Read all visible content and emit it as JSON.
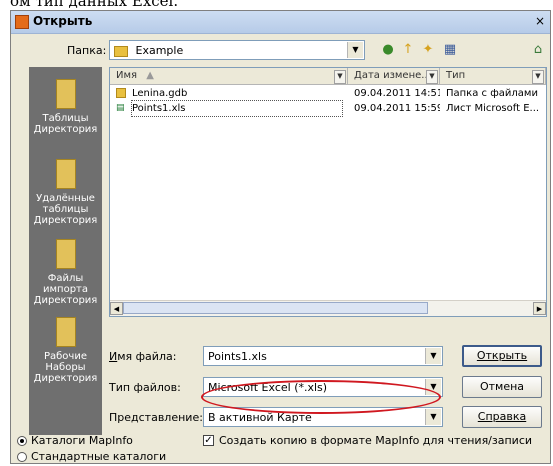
{
  "page_caption": "ом тип данных Excel.",
  "window": {
    "title": "Открыть",
    "close_glyph": "×"
  },
  "look_in": {
    "label": "Папка:",
    "value": "Example"
  },
  "places": [
    {
      "label": "Таблицы Директория"
    },
    {
      "label": "Удалённые таблицы Директория"
    },
    {
      "label": "Файлы импорта Директория"
    },
    {
      "label": "Рабочие Наборы Директория"
    }
  ],
  "columns": {
    "name": "Имя",
    "date": "Дата измене...",
    "type": "Тип"
  },
  "files": [
    {
      "name": "Lenina.gdb",
      "date": "09.04.2011 14:51",
      "type": "Папка с файлами",
      "icon": "folder-icon"
    },
    {
      "name": "Points1.xls",
      "date": "09.04.2011 15:59",
      "type": "Лист Microsoft E...",
      "icon": "excel-file-icon"
    }
  ],
  "fields": {
    "filename_label": "Имя файла:",
    "filename_value": "Points1.xls",
    "filetype_label": "Тип файлов:",
    "filetype_value": "Microsoft Excel (*.xls)",
    "view_label": "Представление:",
    "view_value": "В активной Карте"
  },
  "buttons": {
    "open": "Открыть",
    "cancel": "Отмена",
    "help": "Справка"
  },
  "options": {
    "radio_mapinfo": "Каталоги MapInfo",
    "radio_standard": "Стандартные каталоги",
    "copy_checkbox": "Создать копию в формате MapInfo для чтения/записи",
    "radio_mapinfo_selected": true,
    "copy_checked": true
  },
  "highlight_color": "#d01820"
}
